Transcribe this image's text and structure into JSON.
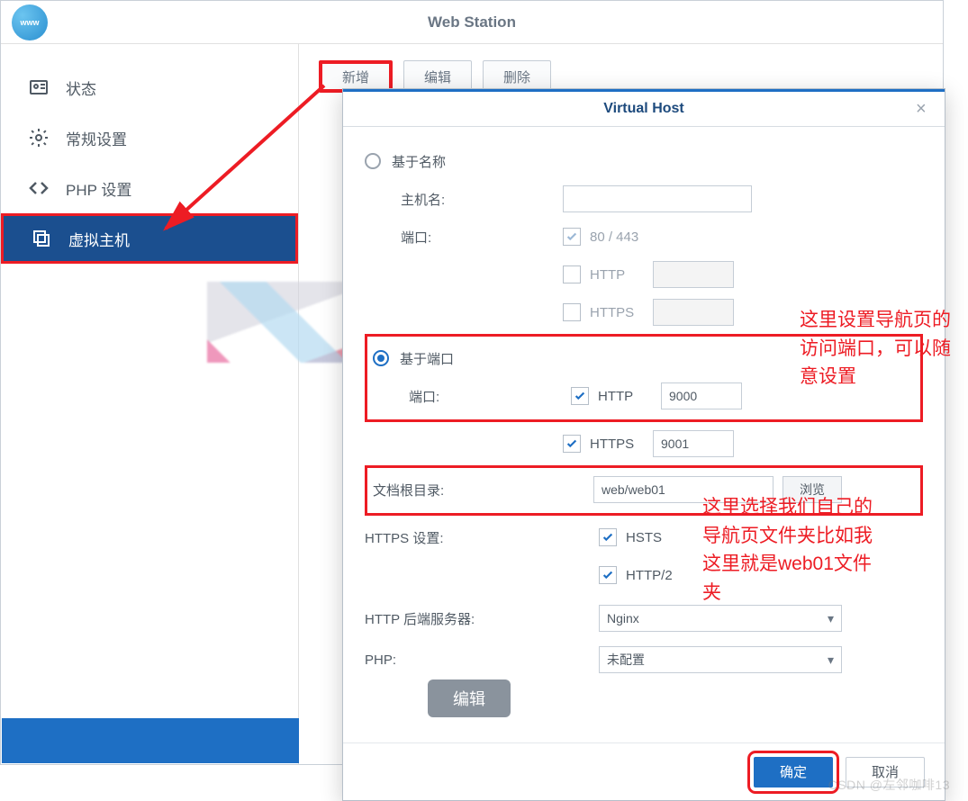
{
  "app": {
    "title": "Web Station",
    "logo_text": "www"
  },
  "sidebar": {
    "items": [
      {
        "label": "状态"
      },
      {
        "label": "常规设置"
      },
      {
        "label": "PHP 设置"
      },
      {
        "label": "虚拟主机"
      }
    ]
  },
  "toolbar": {
    "add": "新增",
    "edit": "编辑",
    "delete": "删除"
  },
  "dialog": {
    "title": "Virtual Host",
    "name_based": "基于名称",
    "hostname": "主机名:",
    "port": "端口:",
    "default_ports": "80 / 443",
    "http": "HTTP",
    "https": "HTTPS",
    "port_based": "基于端口",
    "http_port": "9000",
    "https_port": "9001",
    "docroot_label": "文档根目录:",
    "docroot_value": "web/web01",
    "browse": "浏览",
    "https_settings": "HTTPS 设置:",
    "hsts": "HSTS",
    "http2": "HTTP/2",
    "backend_label": "HTTP 后端服务器:",
    "backend_value": "Nginx",
    "php_label": "PHP:",
    "php_value": "未配置",
    "edit_badge": "编辑",
    "ok": "确定",
    "cancel": "取消"
  },
  "annotations": {
    "a1": "这里设置导航页的访问端口，可以随意设置",
    "a2": "这里选择我们自己的导航页文件夹比如我这里就是web01文件夹"
  },
  "watermark": "CSDN @左邻咖啡13"
}
